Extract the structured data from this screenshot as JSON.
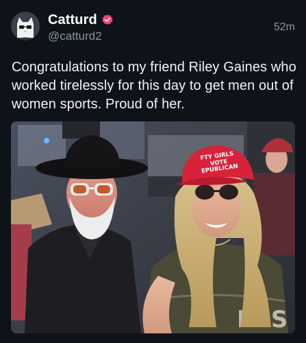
{
  "post": {
    "author": {
      "display_name": "Catturd",
      "handle": "@catturd2",
      "avatar_icon": "cat-avatar-icon",
      "verified_icon": "verified-badge-icon",
      "verified_color": "#f3426e"
    },
    "timestamp": "52m",
    "text": "Congratulations to my friend Riley Gaines who worked tirelessly for this day to get men out of women sports. Proud of her.",
    "media": {
      "type": "photo",
      "hat_text_line1": "FTY GIRLS",
      "hat_text_line2": "VOTE",
      "hat_text_line3": "EPUBLICAN"
    }
  },
  "colors": {
    "background": "#0e1219",
    "text": "#f3f4f6",
    "muted": "#8d95a3",
    "accent": "#f3426e"
  }
}
